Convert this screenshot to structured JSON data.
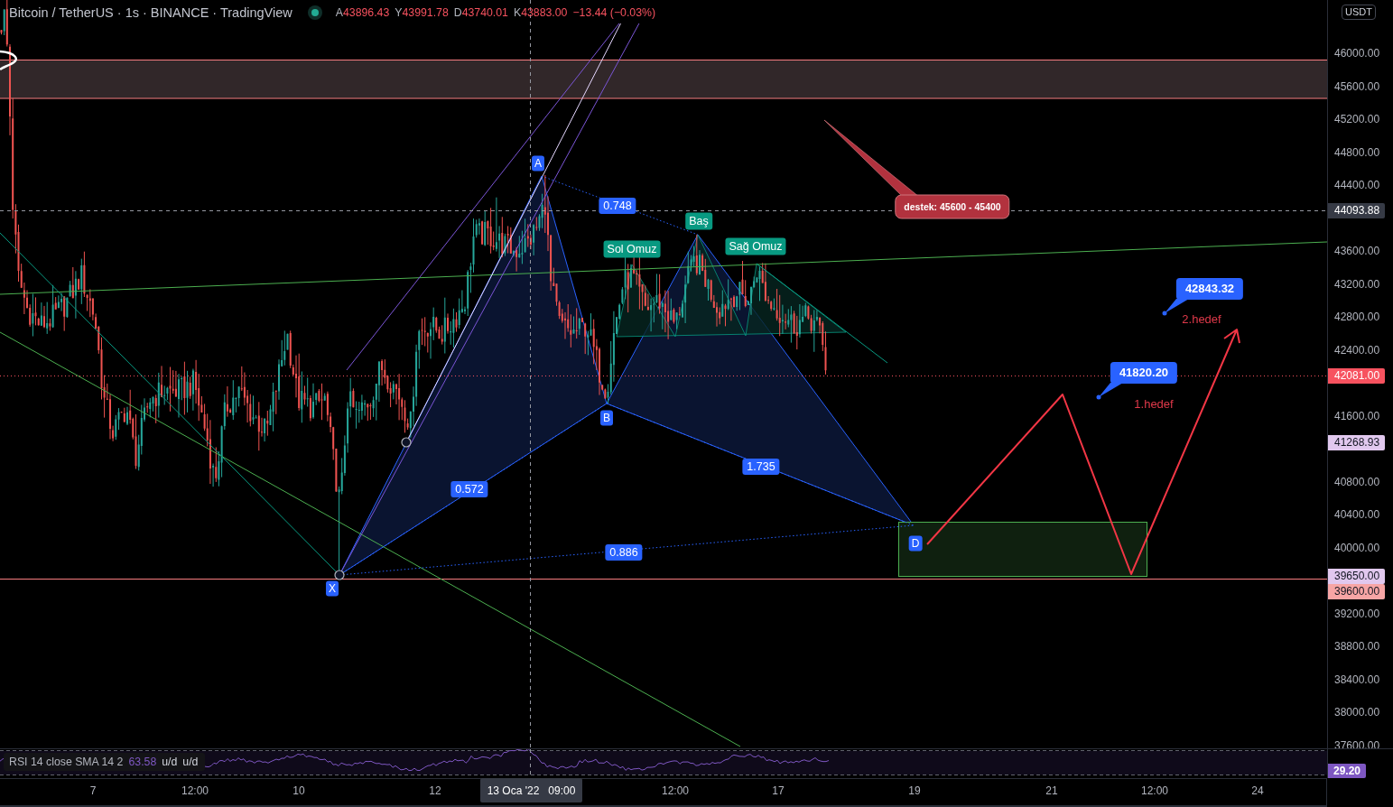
{
  "legend": {
    "symbol": "Bitcoin / TetherUS · 1s · BINANCE · TradingView",
    "market_open": true,
    "price_falling": true,
    "ohlc": [
      {
        "label": "A",
        "value": "43896.43"
      },
      {
        "label": "Y",
        "value": "43991.78"
      },
      {
        "label": "D",
        "value": "43740.01"
      },
      {
        "label": "K",
        "value": "43883.00"
      }
    ],
    "change": "−13.44 (−0.03%)"
  },
  "drawings": {
    "note_callout": "destek: 45600 - 45400",
    "harmonic_points": [
      "X",
      "A",
      "B",
      "D"
    ],
    "harmonic_ratios": [
      "0.748",
      "0.572",
      "1.735",
      "0.886"
    ],
    "pattern_labels": [
      "Sol Omuz",
      "Baş",
      "Sağ Omuz"
    ],
    "price_callouts": [
      "42843.32",
      "41820.20"
    ],
    "target_texts": [
      "2.hedef",
      "1.hedef"
    ]
  },
  "price_axis": {
    "currency": "USDT",
    "ticks": [
      "46000.00",
      "45600.00",
      "45200.00",
      "44800.00",
      "44400.00",
      "43600.00",
      "43200.00",
      "42800.00",
      "42400.00",
      "41600.00",
      "40800.00",
      "40400.00",
      "40000.00",
      "39200.00",
      "38800.00",
      "38400.00",
      "38000.00",
      "37600.00"
    ],
    "markers": [
      {
        "text": "44093.88",
        "color": "#363a45"
      },
      {
        "text": "42081.00",
        "color": "#f7525f"
      },
      {
        "text": "41268.93",
        "color": "#e1c8ee"
      },
      {
        "text": "39650.00",
        "color": "#e1c8ee"
      },
      {
        "text": "39600.00",
        "color": "#f7a5a5"
      }
    ]
  },
  "rsi": {
    "title": "RSI 14 close SMA 14 2",
    "value": "63.58",
    "extras": [
      "u/d",
      "u/d"
    ],
    "axis_label": "29.20"
  },
  "time_axis": {
    "ticks": [
      "7",
      "12:00",
      "10",
      "12",
      "12:00",
      "17",
      "19",
      "21",
      "12:00",
      "24"
    ],
    "crosshair_date": "13 Oca '22",
    "crosshair_time": "09:00"
  }
}
